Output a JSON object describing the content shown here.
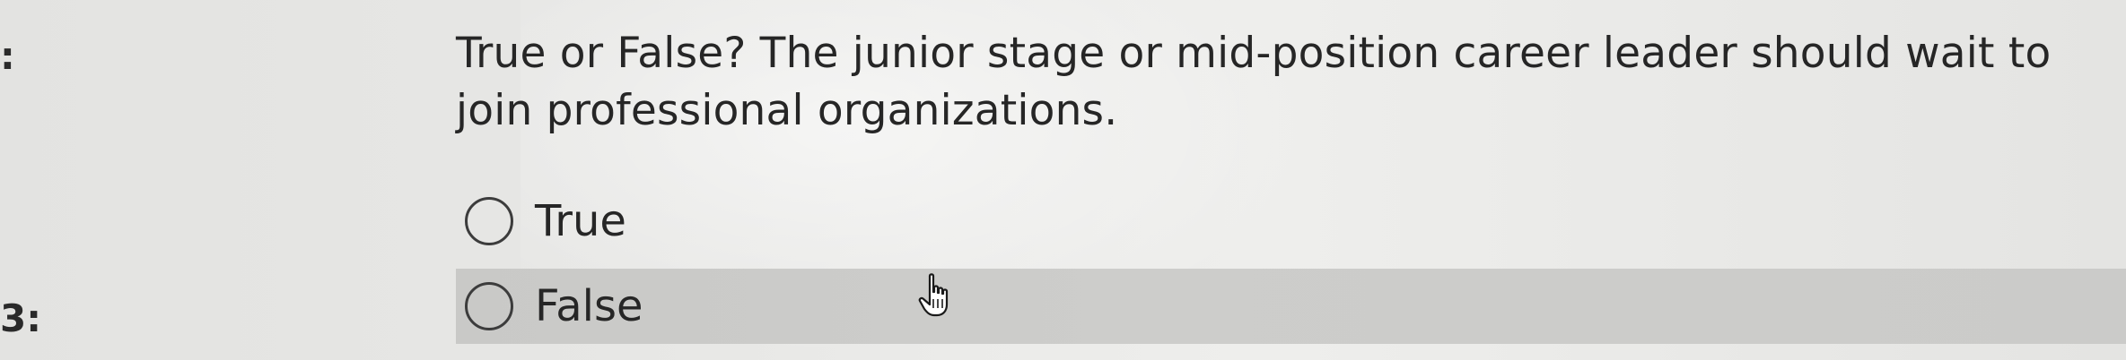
{
  "quiz": {
    "question_marker_1": ":",
    "question_marker_2": "3:",
    "question_text": "True or False? The junior stage or mid-position career leader should wait to join professional organizations.",
    "options": [
      {
        "label": "True",
        "selected": false,
        "hovered": false
      },
      {
        "label": "False",
        "selected": false,
        "hovered": true
      }
    ]
  },
  "icons": {
    "radio": "radio-button-icon",
    "cursor": "hand-pointer-cursor-icon"
  },
  "colors": {
    "background": "#e7e7e5",
    "hover_row": "#cbcbc9",
    "text": "#262626",
    "radio_border": "#3c3c3c"
  }
}
